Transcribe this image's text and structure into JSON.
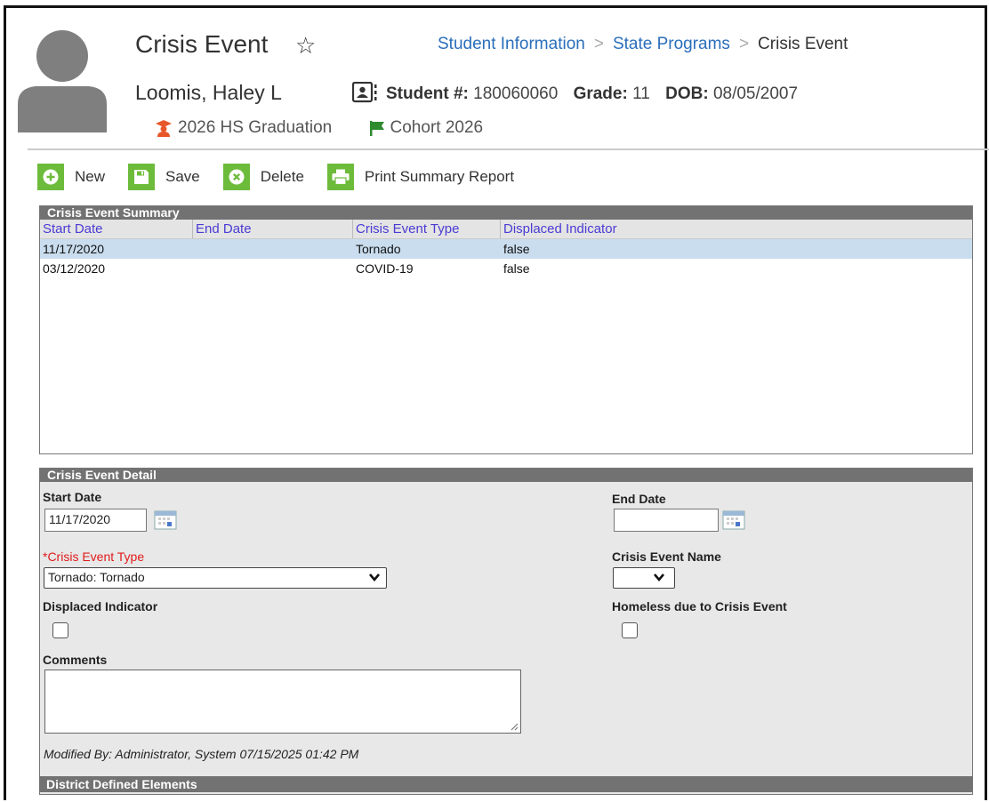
{
  "header": {
    "title": "Crisis Event",
    "breadcrumb": [
      "Student Information",
      "State Programs",
      "Crisis Event"
    ],
    "student_name": "Loomis, Haley L",
    "student_num_label": "Student #:",
    "student_num": "180060060",
    "grade_label": "Grade:",
    "grade": "11",
    "dob_label": "DOB:",
    "dob": "08/05/2007",
    "graduation": "2026 HS Graduation",
    "cohort": "Cohort 2026"
  },
  "toolbar": {
    "new_label": "New",
    "save_label": "Save",
    "delete_label": "Delete",
    "print_label": "Print Summary Report"
  },
  "summary": {
    "title": "Crisis Event Summary",
    "columns": [
      "Start Date",
      "End Date",
      "Crisis Event Type",
      "Displaced Indicator"
    ],
    "rows": [
      [
        "11/17/2020",
        "",
        "Tornado",
        "false"
      ],
      [
        "03/12/2020",
        "",
        "COVID-19",
        "false"
      ]
    ]
  },
  "detail": {
    "title": "Crisis Event Detail",
    "start_date_label": "Start Date",
    "start_date": "11/17/2020",
    "end_date_label": "End Date",
    "end_date": "",
    "type_label": "*Crisis Event Type",
    "type_value": "Tornado: Tornado",
    "name_label": "Crisis Event Name",
    "name_value": "",
    "displaced_label": "Displaced Indicator",
    "homeless_label": "Homeless due to Crisis Event",
    "comments_label": "Comments",
    "modified": "Modified By: Administrator, System 07/15/2025 01:42 PM"
  },
  "district": {
    "title": "District Defined Elements"
  },
  "colors": {
    "accent_green": "#6dbb3b",
    "link_blue": "#2a6ebb",
    "header_gray": "#727272",
    "selected_row": "#c9ddee"
  }
}
